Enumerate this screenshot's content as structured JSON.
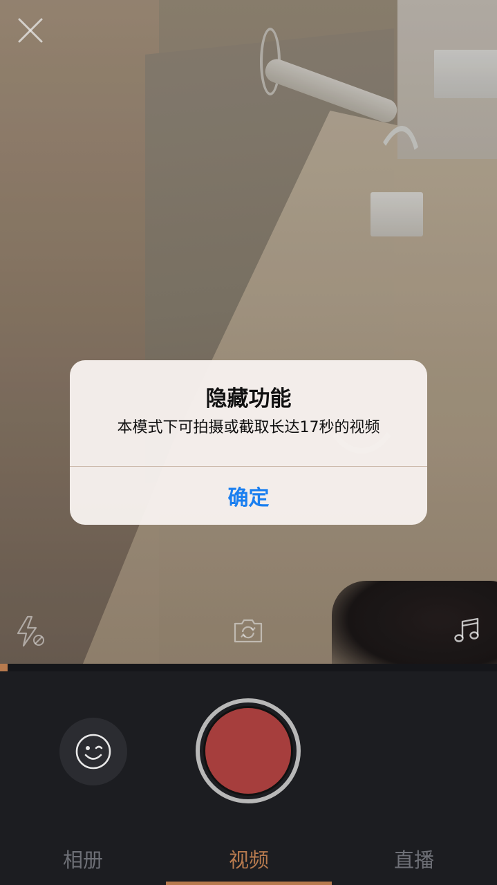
{
  "dialog": {
    "title": "隐藏功能",
    "message": "本模式下可拍摄或截取长达17秒的视频",
    "confirm_label": "确定"
  },
  "controls": {
    "close_icon": "close-icon",
    "flash_icon": "flash-off-icon",
    "flip_icon": "camera-flip-icon",
    "music_icon": "music-note-icon",
    "sticker_icon": "face-sticker-icon"
  },
  "recording": {
    "progress": 0.015
  },
  "tabs": [
    {
      "label": "相册",
      "active": false
    },
    {
      "label": "视频",
      "active": true
    },
    {
      "label": "直播",
      "active": false
    }
  ],
  "colors": {
    "accent": "#b77a4e",
    "shutter": "#a63e3d",
    "dialog_button": "#1a7ff0",
    "panel_bg": "#1c1d21"
  }
}
